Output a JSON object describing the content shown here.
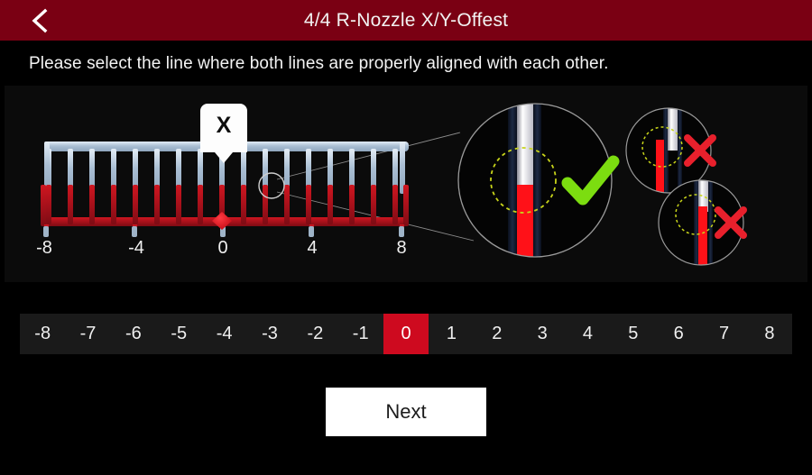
{
  "header": {
    "back_icon": "chevron-left-icon",
    "title": "4/4 R-Nozzle X/Y-Offest",
    "bar_color": "#7a0013"
  },
  "instruction": {
    "text": "Please select the line where both lines are properly aligned with each other."
  },
  "illustration": {
    "tag_label": "X",
    "axis_ticks": [
      "-8",
      "-4",
      "0",
      "4",
      "8"
    ],
    "comb": {
      "top_rail_color": "#b8cbdd",
      "bottom_rail_color": "#b41118",
      "tooth_count": 17,
      "marker_color": "#e21020"
    },
    "detail_good": {
      "status_icon": "check-icon",
      "status_color": "#7cdd10",
      "highlight_ring_color": "#c8d41a"
    },
    "detail_bad_upper": {
      "status_icon": "cross-icon",
      "status_color": "#e8202c",
      "highlight_ring_color": "#c8d41a"
    },
    "detail_bad_lower": {
      "status_icon": "cross-icon",
      "status_color": "#e8202c",
      "highlight_ring_color": "#c8d41a"
    }
  },
  "value_selector": {
    "options": [
      "-8",
      "-7",
      "-6",
      "-5",
      "-4",
      "-3",
      "-2",
      "-1",
      "0",
      "1",
      "2",
      "3",
      "4",
      "5",
      "6",
      "7",
      "8"
    ],
    "selected_index": 8,
    "selected_value": "0",
    "selected_color": "#ce0a1f",
    "track_color": "#1a1a1a"
  },
  "footer": {
    "next_label": "Next"
  }
}
